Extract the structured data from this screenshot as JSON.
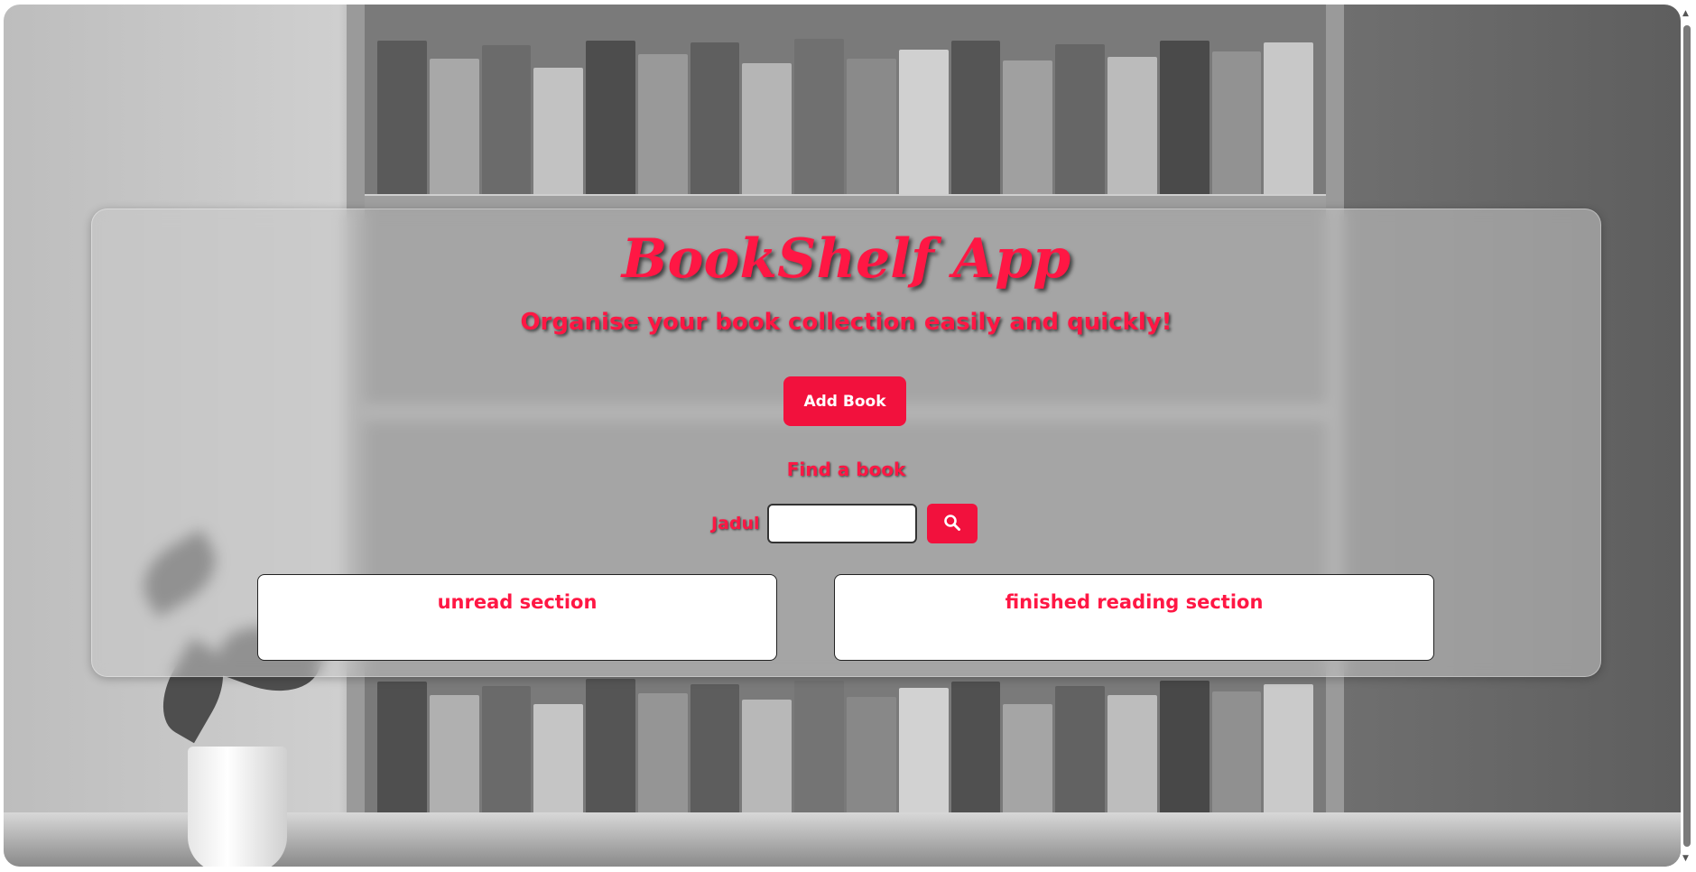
{
  "app": {
    "title": "BookShelf App",
    "subtitle": "Organise your book collection easily and quickly!"
  },
  "actions": {
    "add_book_label": "Add Book"
  },
  "search": {
    "heading": "Find a book",
    "field_label": "Jadul",
    "value": "",
    "button_icon": "search-icon"
  },
  "sections": {
    "unread_title": "unread section",
    "finished_title": "finished reading section"
  },
  "colors": {
    "accent": "#ff1744",
    "button": "#f2113d",
    "panel": "rgba(200,200,200,0.55)"
  }
}
